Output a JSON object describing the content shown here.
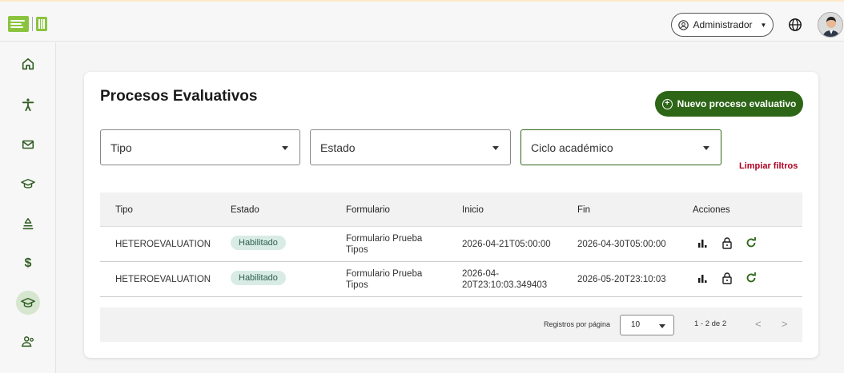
{
  "header": {
    "role_label": "Administrador"
  },
  "page": {
    "title": "Procesos Evaluativos",
    "new_button": "Nuevo proceso evaluativo",
    "clear_filters": "Limpiar filtros"
  },
  "filters": {
    "tipo": "Tipo",
    "estado": "Estado",
    "ciclo": "Ciclo académico"
  },
  "table": {
    "headers": [
      "Tipo",
      "Estado",
      "Formulario",
      "Inicio",
      "Fin",
      "Acciones"
    ],
    "rows": [
      {
        "tipo": "HETEROEVALUATION",
        "estado": "Habilitado",
        "formulario_1": "Formulario Prueba",
        "formulario_2": "Tipos",
        "inicio_1": "2026-04-21T05:00:00",
        "inicio_2": "",
        "fin": "2026-04-30T05:00:00"
      },
      {
        "tipo": "HETEROEVALUATION",
        "estado": "Habilitado",
        "formulario_1": "Formulario Prueba",
        "formulario_2": "Tipos",
        "inicio_1": "2026-04-",
        "inicio_2": "20T23:10:03.349403",
        "fin": "2026-05-20T23:10:03"
      }
    ]
  },
  "pagination": {
    "rows_per_page_label": "Registros por página",
    "rows_per_page": "10",
    "range": "1 - 2 de 2",
    "prev": "<",
    "next": ">"
  },
  "colors": {
    "primary": "#2d6616",
    "danger": "#b00020",
    "badge_bg": "#d8ece5"
  },
  "icons": {
    "sidebar": [
      "home-icon",
      "accessibility-icon",
      "mail-icon",
      "graduation-cap-icon",
      "stack-icon",
      "dollar-icon",
      "graduation-cap-icon",
      "people-icon"
    ],
    "row_actions": [
      "bar-chart-icon",
      "lock-icon",
      "refresh-icon"
    ]
  }
}
